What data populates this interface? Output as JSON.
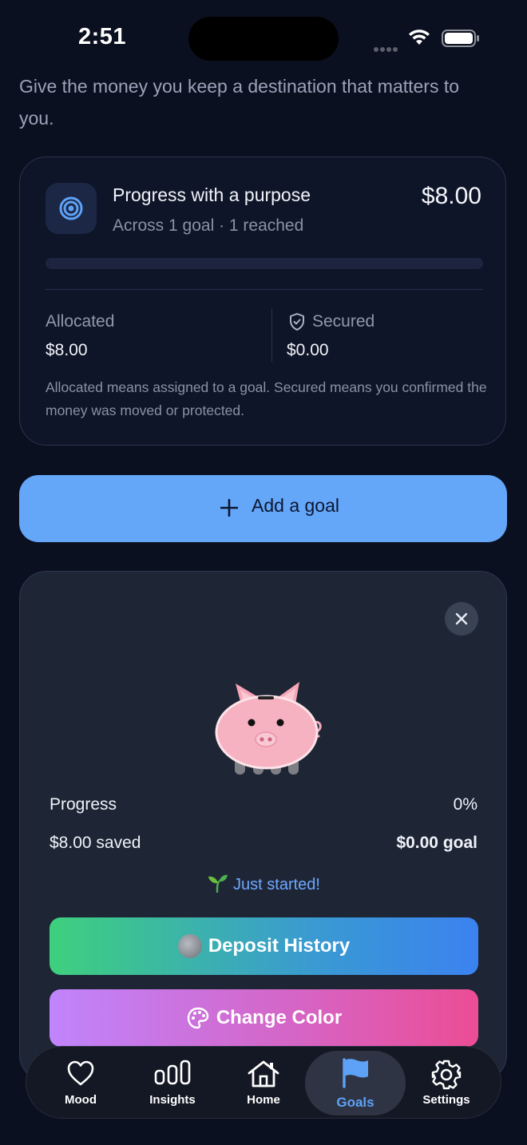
{
  "status_bar": {
    "time": "2:51"
  },
  "subtitle": "Give the money you keep a destination that matters to you.",
  "summary": {
    "title": "Progress with a purpose",
    "amount": "$8.00",
    "subtitle": "Across 1 goal · 1 reached",
    "progress_fraction": 0,
    "allocated_label": "Allocated",
    "allocated_value": "$8.00",
    "secured_label": "Secured",
    "secured_value": "$0.00",
    "note": "Allocated means assigned to a goal. Secured means you confirmed the money was moved or protected."
  },
  "add_goal_label": "Add a goal",
  "goal": {
    "progress_label": "Progress",
    "progress_pct": "0%",
    "saved": "$8.00 saved",
    "goal_amount": "$0.00 goal",
    "status": "Just started!",
    "deposit_history_label": "Deposit History",
    "change_color_label": "Change Color"
  },
  "tabs": [
    {
      "label": "Mood",
      "icon": "heart-icon"
    },
    {
      "label": "Insights",
      "icon": "bar-chart-icon"
    },
    {
      "label": "Home",
      "icon": "home-icon"
    },
    {
      "label": "Goals",
      "icon": "flag-icon",
      "active": true
    },
    {
      "label": "Settings",
      "icon": "gear-icon"
    }
  ],
  "colors": {
    "background": "#0b1020",
    "accent": "#64a6f8",
    "active_tab": "#5ea2f7"
  }
}
